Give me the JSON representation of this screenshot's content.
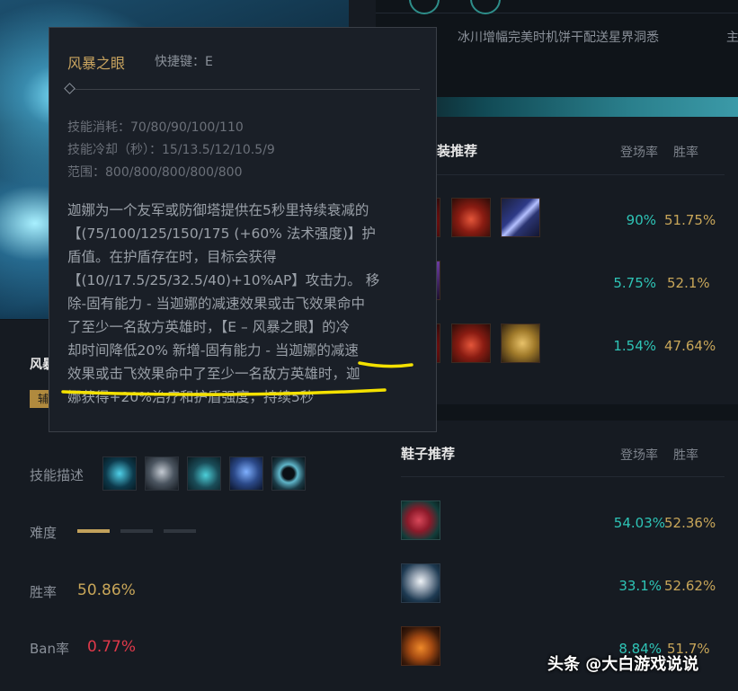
{
  "hero": {
    "name": "风暴之怒",
    "name_visible": "风暴",
    "role": "辅"
  },
  "stats": {
    "skills_label": "技能描述",
    "difficulty_label": "难度",
    "difficulty_level": 1,
    "difficulty_max": 3,
    "winrate_label": "胜率",
    "winrate_value": "50.86%",
    "banrate_label": "Ban率",
    "banrate_value": "0.77%"
  },
  "skills": [
    {
      "icon": "passive-skill-icon"
    },
    {
      "icon": "q-skill-icon"
    },
    {
      "icon": "w-skill-icon"
    },
    {
      "icon": "e-skill-icon"
    },
    {
      "icon": "r-skill-icon"
    }
  ],
  "top_strip": {
    "item_sets_text": "冰川增幅完美时机饼干配送星界洞悉",
    "edge_char": "主"
  },
  "build_card": {
    "title_visible": "装推荐",
    "col_pick": "登场率",
    "col_win": "胜率",
    "rows": [
      {
        "pick": "90%",
        "win": "51.75%",
        "items": [
          "red-item-icon",
          "red-potion-icon",
          "blade-item-icon"
        ]
      },
      {
        "pick": "5.75%",
        "win": "52.1%",
        "items": [
          "purple-item-icon"
        ]
      },
      {
        "pick": "1.54%",
        "win": "47.64%",
        "items": [
          "red-item-icon",
          "red-potion-icon",
          "gold-shield-icon"
        ]
      }
    ]
  },
  "boots_card": {
    "title": "鞋子推荐",
    "col_pick": "登场率",
    "col_win": "胜率",
    "rows": [
      {
        "pick": "54.03%",
        "win": "52.36%",
        "icon": "red-boots-icon"
      },
      {
        "pick": "33.1%",
        "win": "52.62%",
        "icon": "winged-boots-icon"
      },
      {
        "pick": "8.84%",
        "win": "51.7%",
        "icon": "orange-boots-icon"
      }
    ]
  },
  "tooltip": {
    "skill_name": "风暴之眼",
    "hotkey": "快捷键：E",
    "cost": "技能消耗：70/80/90/100/110",
    "cooldown": "技能冷却（秒）：15/13.5/12/10.5/9",
    "range": "范围：800/800/800/800/800",
    "desc_lines": [
      "迦娜为一个友军或防御塔提供在5秒里持续衰减的",
      "【(75/100/125/150/175 (+60% 法术强度)】护",
      "盾值。在护盾存在时，目标会获得",
      "【(10//17.5/25/32.5/40)+10%AP】攻击力。 移",
      "除-固有能力 - 当迦娜的减速效果或击飞效果命中",
      "了至少一名敌方英雄时，【E – 风暴之眼】的冷",
      "却时间降低20% 新增-固有能力 - 当迦娜的减速",
      "效果或击飞效果命中了至少一名敌方英雄时，迦",
      "娜获得+20%治疗和护盾强度，持续5秒"
    ]
  },
  "watermark": "头条 @大白游戏说说",
  "colors": {
    "accent_gold": "#c9a45f",
    "pick_teal": "#2ec4b6",
    "win_gold": "#c8a659",
    "ban_red": "#e0394a",
    "highlight_yellow": "#f4e100"
  }
}
